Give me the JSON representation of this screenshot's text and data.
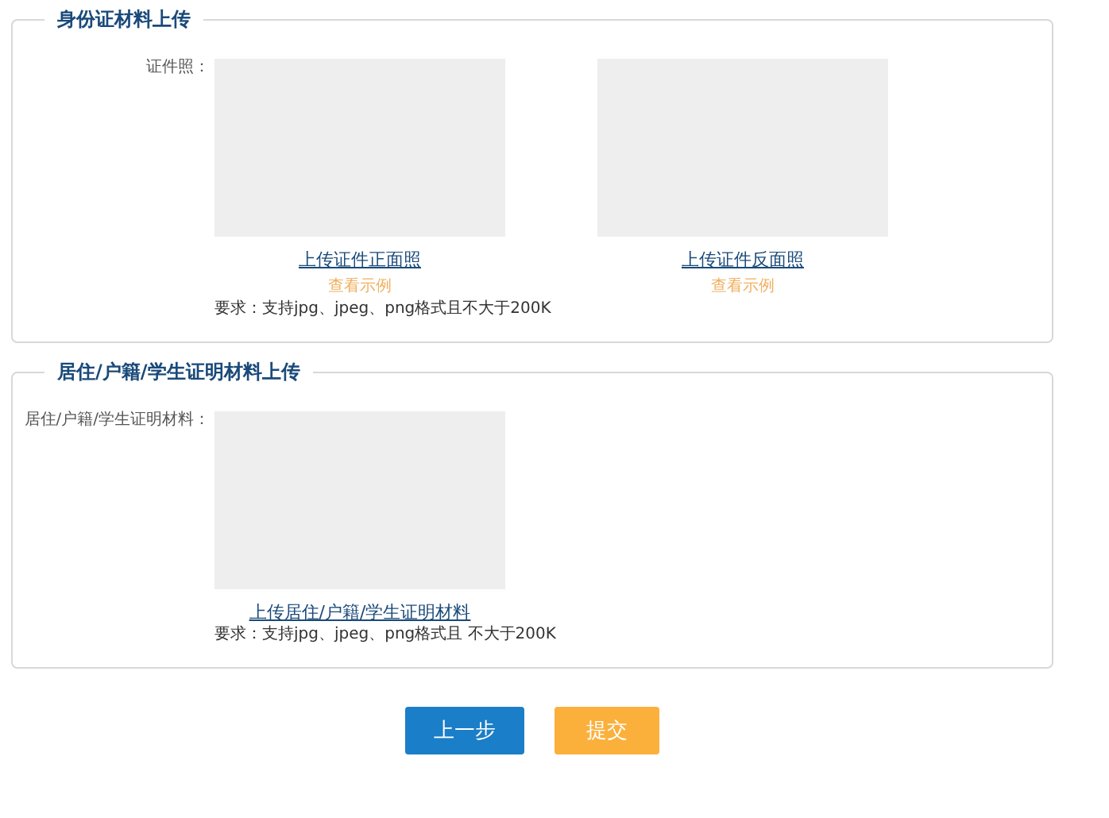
{
  "sections": [
    {
      "title": "身份证材料上传",
      "label": "证件照：",
      "uploads": [
        {
          "link": "上传证件正面照",
          "example": "查看示例",
          "requirement": "要求：支持jpg、jpeg、png格式且不大于200K"
        },
        {
          "link": "上传证件反面照",
          "example": "查看示例"
        }
      ]
    },
    {
      "title": "居住/户籍/学生证明材料上传",
      "label": "居住/户籍/学生证明材料：",
      "uploads": [
        {
          "link": "上传居住/户籍/学生证明材料",
          "requirement": "要求：支持jpg、jpeg、png格式且 不大于200K"
        }
      ]
    }
  ],
  "buttons": [
    {
      "label": "上一步",
      "kind": "primary"
    },
    {
      "label": "提交",
      "kind": "warning"
    }
  ]
}
